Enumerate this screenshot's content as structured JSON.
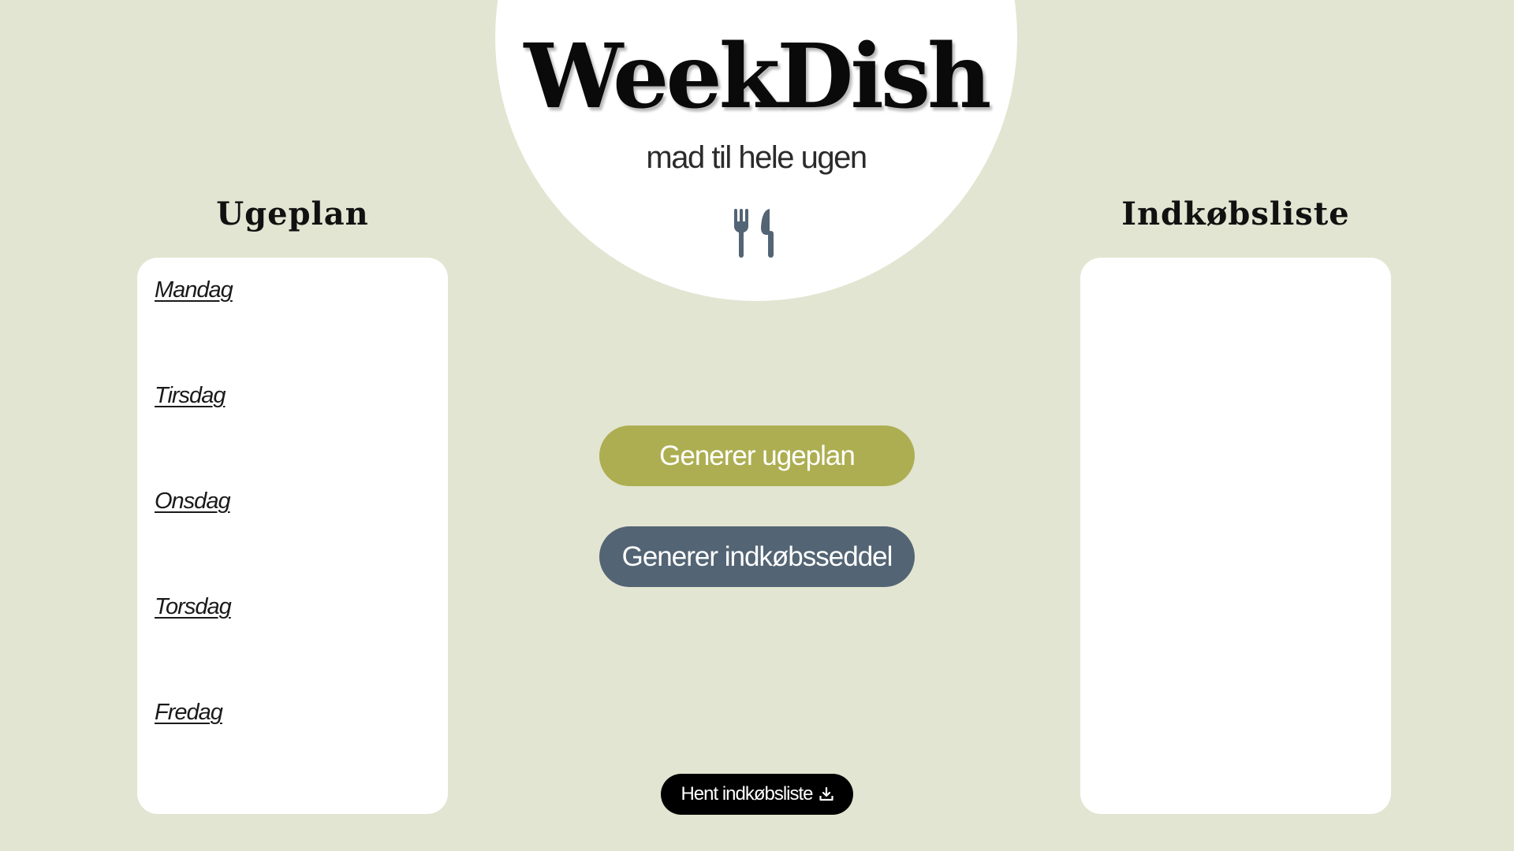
{
  "brand": {
    "name": "WeekDish",
    "tagline": "mad til hele ugen"
  },
  "weekplan": {
    "title": "Ugeplan",
    "days": [
      "Mandag",
      "Tirsdag",
      "Onsdag",
      "Torsdag",
      "Fredag"
    ]
  },
  "shopping": {
    "title": "Indkøbsliste"
  },
  "actions": {
    "generate_plan": "Generer ugeplan",
    "generate_list": "Generer indkøbsseddel",
    "download_list": "Hent indkøbsliste"
  },
  "icons": {
    "cutlery": "fork-knife-icon",
    "download": "download-icon"
  },
  "colors": {
    "background": "#e2e5d1",
    "accent_olive": "#adae51",
    "accent_slate": "#536474",
    "icon": "#536474",
    "dark": "#000000"
  }
}
